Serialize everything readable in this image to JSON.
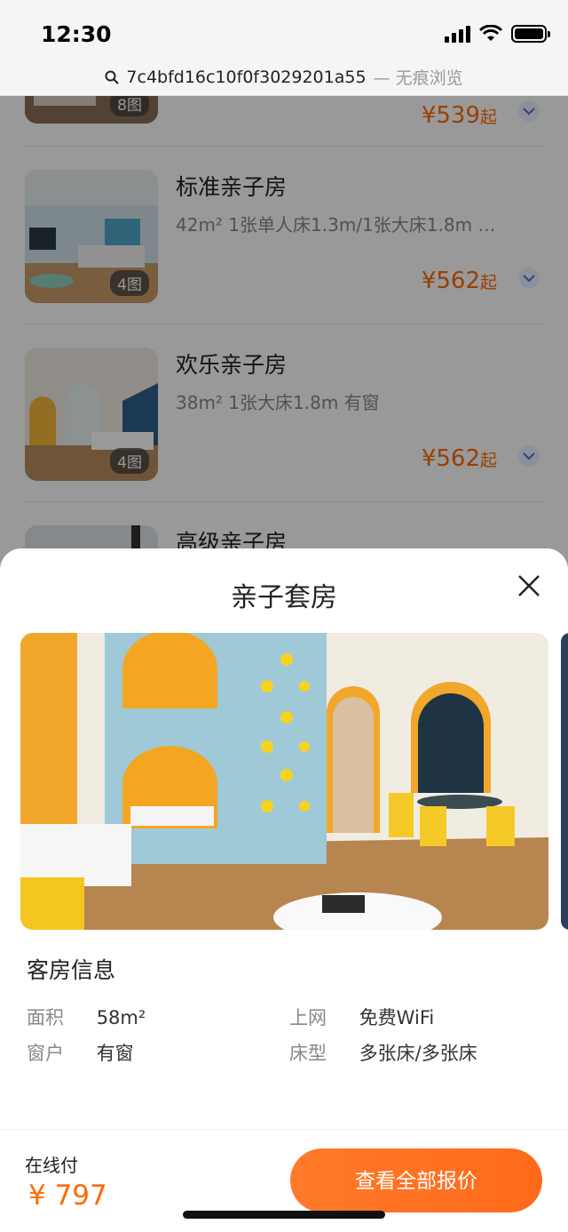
{
  "status_bar": {
    "time": "12:30"
  },
  "url_bar": {
    "url": "7c4bfd16c10f0f3029201a55",
    "mode": "— 无痕浏览"
  },
  "rooms": [
    {
      "name": "",
      "desc": "",
      "photos": "8图",
      "price": "¥539",
      "price_suffix": "起"
    },
    {
      "name": "标准亲子房",
      "desc": "42m² 1张单人床1.3m/1张大床1.8m …",
      "photos": "4图",
      "price": "¥562",
      "price_suffix": "起"
    },
    {
      "name": "欢乐亲子房",
      "desc": "38m² 1张大床1.8m 有窗",
      "photos": "4图",
      "price": "¥562",
      "price_suffix": "起"
    },
    {
      "name": "高级亲子房",
      "desc": "",
      "photos": "",
      "price": "",
      "price_suffix": ""
    }
  ],
  "sheet": {
    "title": "亲子套房",
    "info_title": "客房信息",
    "info": [
      {
        "label": "面积",
        "value": "58m²"
      },
      {
        "label": "上网",
        "value": "免费WiFi"
      },
      {
        "label": "窗户",
        "value": "有窗"
      },
      {
        "label": "床型",
        "value": "多张床/多张床"
      }
    ],
    "footer": {
      "pay_label": "在线付",
      "price": "¥ 797",
      "cta": "查看全部报价"
    }
  },
  "icons": {
    "search": "search-icon",
    "close": "close-icon",
    "expand": "chevron-down-icon",
    "wifi": "wifi-icon",
    "signal": "signal-icon",
    "battery": "battery-icon"
  },
  "colors": {
    "accent": "#ff6a00",
    "cta": "#ff7a2a"
  }
}
